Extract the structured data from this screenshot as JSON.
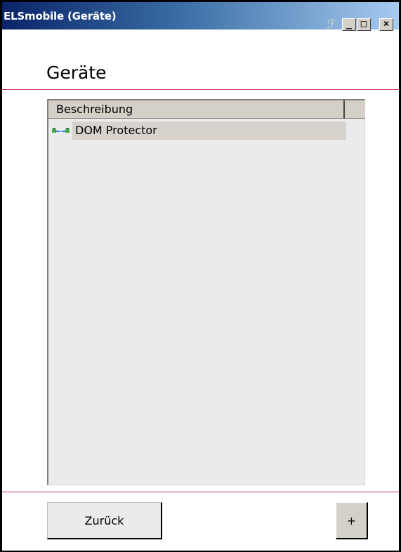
{
  "window": {
    "title": "ELSmobile (Geräte)",
    "controls": {
      "minimize": "_",
      "maximize": "□",
      "close": "×"
    }
  },
  "page": {
    "title": "Geräte"
  },
  "device_list": {
    "column_header": "Beschreibung",
    "rows": [
      {
        "label": "DOM Protector",
        "icon": "device-connected-icon"
      }
    ]
  },
  "buttons": {
    "back_label": "Zurück",
    "add_label": "+"
  },
  "colors": {
    "separator": "#d4375e",
    "titlebar_start": "#0a246a",
    "titlebar_end": "#a6caf0",
    "list_background": "#ebebeb",
    "selection": "#d7d3cc"
  }
}
